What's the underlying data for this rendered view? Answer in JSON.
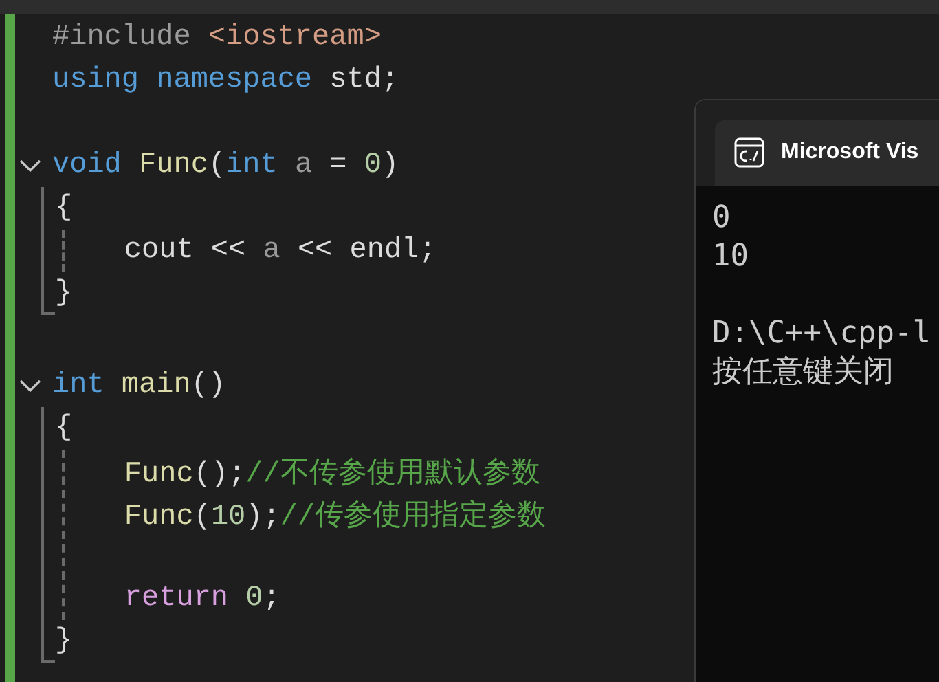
{
  "editor": {
    "lines": [
      {
        "kind": "code",
        "tokens": [
          {
            "text": "#include ",
            "kind": "preproc"
          },
          {
            "text": "<iostream>",
            "kind": "string"
          }
        ]
      },
      {
        "kind": "code",
        "tokens": [
          {
            "text": "using namespace ",
            "kind": "keyword"
          },
          {
            "text": "std;",
            "kind": "plain"
          }
        ]
      },
      {
        "kind": "blank"
      },
      {
        "kind": "fold",
        "tokens": [
          {
            "text": "void ",
            "kind": "keyword"
          },
          {
            "text": "Func",
            "kind": "func"
          },
          {
            "text": "(",
            "kind": "plain"
          },
          {
            "text": "int ",
            "kind": "keyword"
          },
          {
            "text": "a",
            "kind": "param"
          },
          {
            "text": " = ",
            "kind": "plain"
          },
          {
            "text": "0",
            "kind": "number"
          },
          {
            "text": ")",
            "kind": "plain"
          }
        ],
        "children": [
          {
            "kind": "code",
            "tokens": [
              {
                "text": "{",
                "kind": "plain"
              }
            ]
          },
          {
            "kind": "indent",
            "children": [
              {
                "kind": "code",
                "tokens": [
                  {
                    "text": "    cout << ",
                    "kind": "plain"
                  },
                  {
                    "text": "a",
                    "kind": "param"
                  },
                  {
                    "text": " << endl;",
                    "kind": "plain"
                  }
                ]
              }
            ]
          },
          {
            "kind": "code",
            "tokens": [
              {
                "text": "}",
                "kind": "plain"
              }
            ]
          }
        ]
      },
      {
        "kind": "blank"
      },
      {
        "kind": "fold",
        "tokens": [
          {
            "text": "int ",
            "kind": "keyword"
          },
          {
            "text": "main",
            "kind": "func"
          },
          {
            "text": "()",
            "kind": "plain"
          }
        ],
        "children": [
          {
            "kind": "code",
            "tokens": [
              {
                "text": "{",
                "kind": "plain"
              }
            ]
          },
          {
            "kind": "indent",
            "children": [
              {
                "kind": "code",
                "tokens": [
                  {
                    "text": "    Func",
                    "kind": "func"
                  },
                  {
                    "text": "();",
                    "kind": "plain"
                  },
                  {
                    "text": "//不传参使用默认参数",
                    "kind": "comment"
                  }
                ]
              },
              {
                "kind": "code",
                "tokens": [
                  {
                    "text": "    Func",
                    "kind": "func"
                  },
                  {
                    "text": "(",
                    "kind": "plain"
                  },
                  {
                    "text": "10",
                    "kind": "number"
                  },
                  {
                    "text": ");",
                    "kind": "plain"
                  },
                  {
                    "text": "//传参使用指定参数",
                    "kind": "comment"
                  }
                ]
              },
              {
                "kind": "blank"
              },
              {
                "kind": "code",
                "tokens": [
                  {
                    "text": "    return ",
                    "kind": "control"
                  },
                  {
                    "text": "0",
                    "kind": "number"
                  },
                  {
                    "text": ";",
                    "kind": "plain"
                  }
                ]
              }
            ]
          },
          {
            "kind": "code",
            "tokens": [
              {
                "text": "}",
                "kind": "plain"
              }
            ]
          }
        ]
      }
    ]
  },
  "console": {
    "title": "Microsoft Vis",
    "output": [
      [
        "0",
        "10"
      ],
      [
        "D:\\C++\\cpp-l",
        "按任意键关闭"
      ]
    ]
  }
}
